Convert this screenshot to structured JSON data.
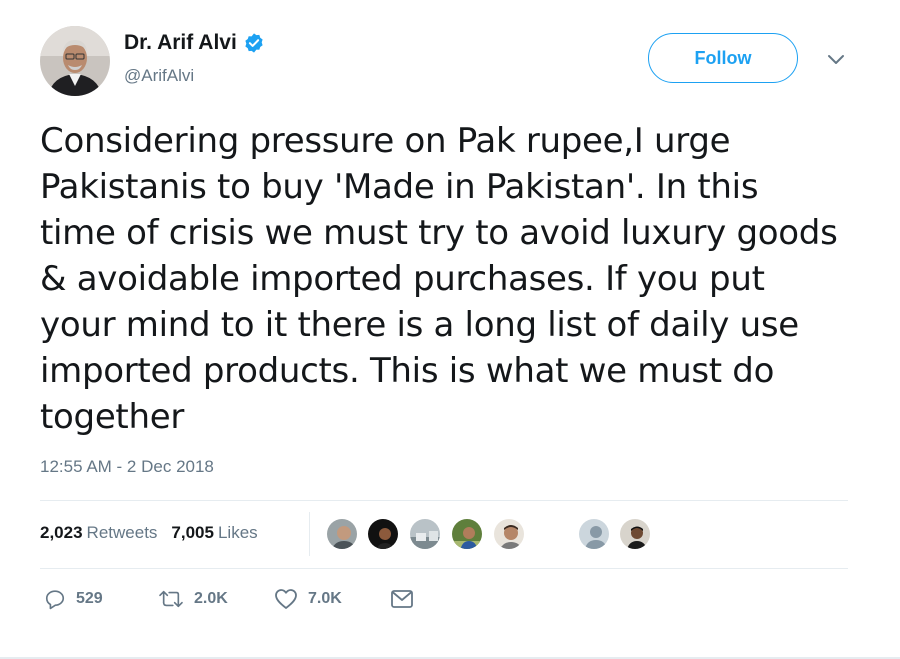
{
  "author": {
    "display_name": "Dr. Arif Alvi",
    "handle": "@ArifAlvi",
    "verified": true
  },
  "header": {
    "follow_label": "Follow"
  },
  "tweet": {
    "text": "Considering pressure on Pak rupee,I urge Pakistanis to buy 'Made in Pakistan'. In this time of crisis we must try to avoid luxury goods & avoidable imported purchases. If you put your mind to it there is a long list of daily use imported products. This is what we must do together",
    "timestamp": "12:55 AM - 2 Dec 2018"
  },
  "stats": {
    "retweets_count": "2,023",
    "retweets_label": "Retweets",
    "likes_count": "7,005",
    "likes_label": "Likes"
  },
  "actions": {
    "reply_count": "529",
    "retweet_count": "2.0K",
    "like_count": "7.0K"
  },
  "colors": {
    "accent": "#1da1f2",
    "muted": "#657786",
    "text": "#14171a",
    "divider": "#e6ecf0"
  },
  "icons": [
    "verified-badge-icon",
    "chevron-down-icon",
    "reply-icon",
    "retweet-icon",
    "like-heart-icon",
    "direct-message-icon"
  ]
}
